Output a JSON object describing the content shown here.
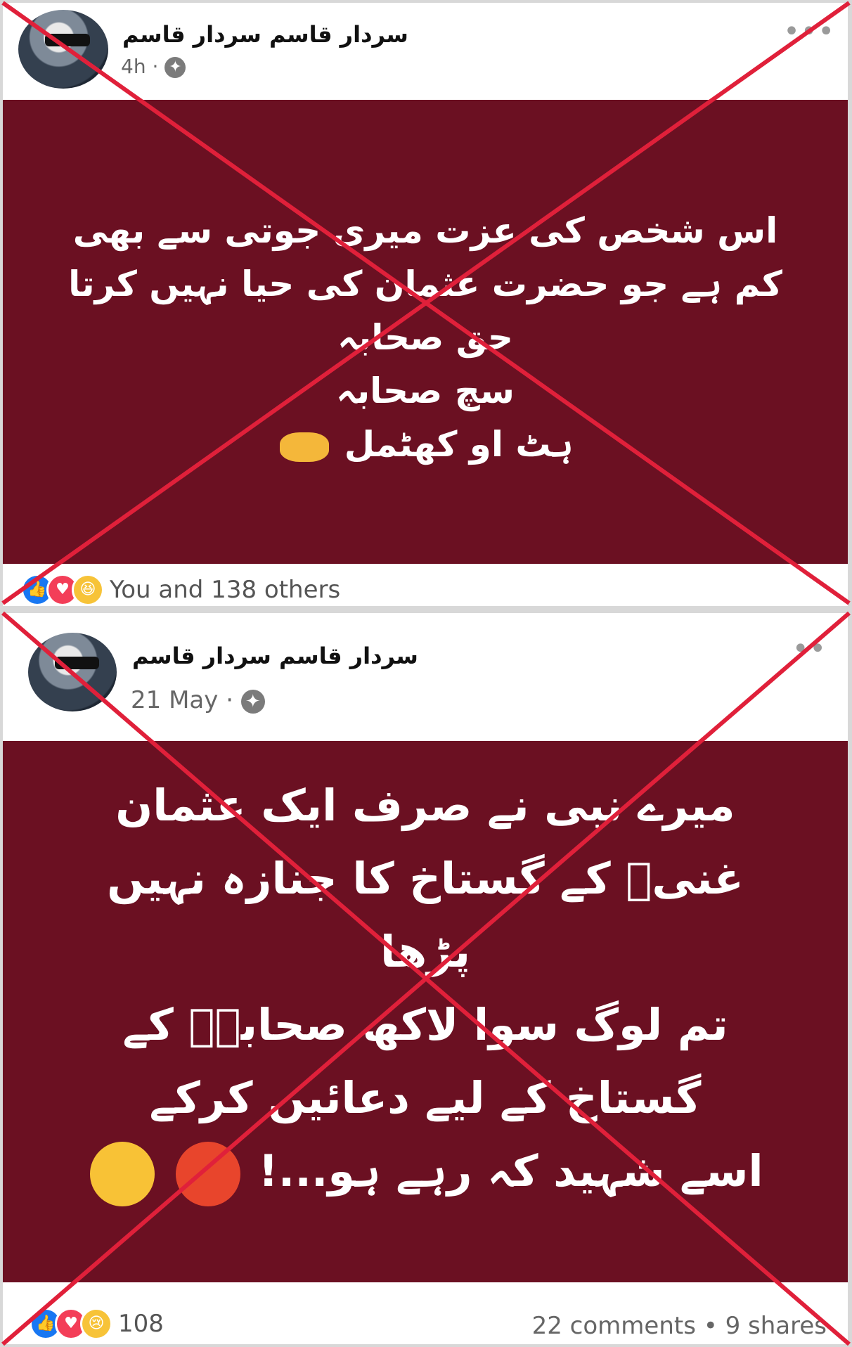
{
  "posts": [
    {
      "author": "سردار قاسم سردار قاسم",
      "time": "4h",
      "separator": "·",
      "text_lines": [
        "اس شخص کی عزت میری جوتی سے بھی",
        "کم ہے جو حضرت عثمان کی حیا نہیں کرتا",
        "حق صحابہ",
        "سچ صحابہ",
        "ہٹ او کھٹمل"
      ],
      "reactions_text": "You and 138 others"
    },
    {
      "author": "سردار قاسم سردار قاسم",
      "time": "21 May",
      "separator": "·",
      "text_lines": [
        "میرے نبی نے صرف ایک عثمان",
        "غنیؓ کے گستاخ کا جنازہ نہیں",
        "پڑھا",
        "تم لوگ سوا لاکھ صحابہؓ کے",
        "گستاخ کے لیے دعائیں کرکے",
        "اسے شہید کہ رہے ہو...!"
      ],
      "reactions_count": "108",
      "comments_shares": "22 comments • 9 shares"
    }
  ],
  "icons": {
    "more": "more-options-icon",
    "globe": "globe-icon",
    "like": "like-reaction-icon",
    "love": "love-reaction-icon",
    "haha": "haha-reaction-icon",
    "sad": "sad-reaction-icon"
  },
  "colors": {
    "post_background": "#6b1022",
    "cross": "#e0203a",
    "like": "#1877f2",
    "love": "#f33e58"
  }
}
